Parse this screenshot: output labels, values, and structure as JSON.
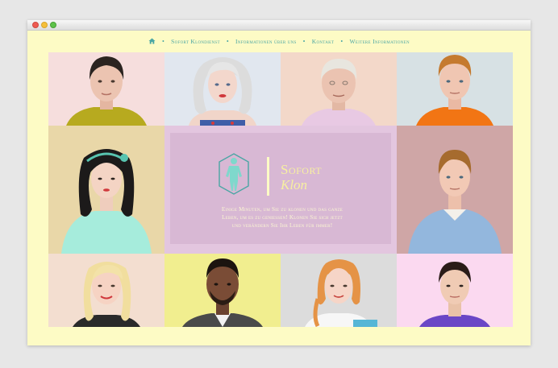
{
  "nav": {
    "items": [
      "Sofort Klondienst",
      "Informationen über uns",
      "Kontakt",
      "Weitere Informationen"
    ]
  },
  "hero": {
    "brand_line1": "Sofort",
    "brand_line2": "Klon",
    "tagline_line1": "Einige Minuten, um Sie zu klonen und das ganze",
    "tagline_line2": "Leben, um es zu geniessen! Klonen Sie sich jetzt",
    "tagline_line3": "und verändern Sie Ihr Leben für immer!"
  },
  "colors": {
    "page_background": "#fdfbc5",
    "nav_text": "#4aa6a4",
    "brand_text": "#f7f0a0",
    "panel": "#d8b8d4"
  },
  "portraits": [
    "man-dark-hair-olive-shirt",
    "woman-silver-wig",
    "older-man-white-hair",
    "young-man-orange-shirt",
    "woman-black-hair-headband",
    "man-blue-sweater",
    "woman-blonde",
    "man-dark-skin-suit",
    "woman-red-hair",
    "woman-purple-top"
  ]
}
